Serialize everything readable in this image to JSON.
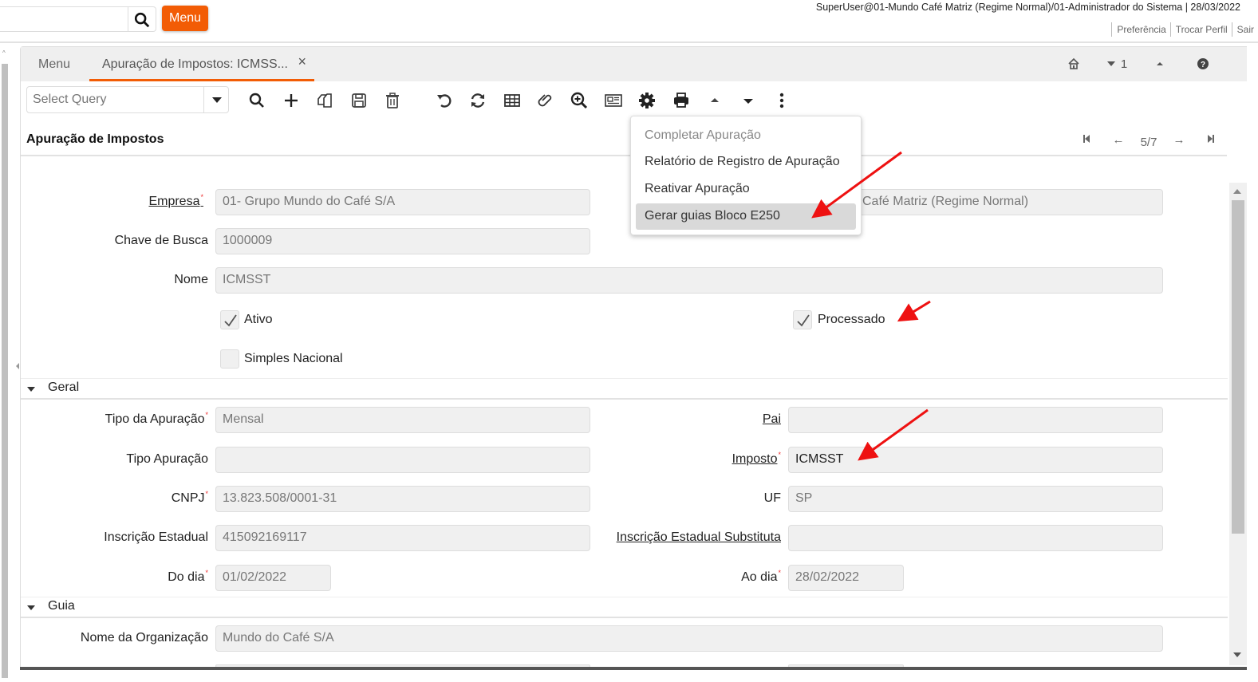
{
  "header": {
    "menu_button": "Menu",
    "user_info": "SuperUser@01-Mundo Café Matriz (Regime Normal)/01-Administrador do Sistema | 28/03/2022",
    "links": [
      "Preferência",
      "Trocar Perfil",
      "Sair"
    ]
  },
  "tabs": {
    "menu_tab": "Menu",
    "active_tab": "Apuração de Impostos: ICMSS...",
    "close_glyph": "×",
    "tools": {
      "home_icon": "home-icon",
      "recent_count": "1",
      "help_icon": "help-icon"
    }
  },
  "toolbar": {
    "query_placeholder": "Select Query",
    "icons": [
      "search-icon",
      "new-record-icon",
      "copy-icon",
      "save-icon",
      "delete-icon",
      "undo-icon",
      "refresh-icon",
      "grid-toggle-icon",
      "attachment-icon",
      "zoom-across-icon",
      "report-icon",
      "process-gear-icon",
      "print-icon",
      "previous-record-icon",
      "next-record-icon",
      "more-options-icon"
    ]
  },
  "record": {
    "title": "Apuração de Impostos",
    "position": "5/7"
  },
  "popup_menu": {
    "items": [
      {
        "label": "Completar Apuração",
        "state": "disabled"
      },
      {
        "label": "Relatório de Registro de Apuração",
        "state": "normal"
      },
      {
        "label": "Reativar Apuração",
        "state": "normal"
      },
      {
        "label": "Gerar guias Bloco E250",
        "state": "hover"
      }
    ]
  },
  "form": {
    "empresa": {
      "label": "Empresa",
      "value": "01- Grupo Mundo do Café S/A"
    },
    "organizacao": {
      "value": "Café Matriz (Regime Normal)"
    },
    "chave_busca": {
      "label": "Chave de Busca",
      "value": "1000009"
    },
    "nome": {
      "label": "Nome",
      "value": "ICMSST"
    },
    "ativo": {
      "label": "Ativo",
      "checked": true
    },
    "processado": {
      "label": "Processado",
      "checked": true
    },
    "simples_nacional": {
      "label": "Simples Nacional",
      "checked": false
    }
  },
  "sections": {
    "geral": {
      "name": "Geral",
      "tipo_da_apuracao": {
        "label": "Tipo da Apuração",
        "value": "Mensal"
      },
      "tipo_apuracao": {
        "label": "Tipo Apuração",
        "value": ""
      },
      "cnpj": {
        "label": "CNPJ",
        "value": "13.823.508/0001-31"
      },
      "inscricao_estadual": {
        "label": "Inscrição Estadual",
        "value": "415092169117"
      },
      "do_dia": {
        "label": "Do dia",
        "value": "01/02/2022"
      },
      "pai": {
        "label": "Pai",
        "value": ""
      },
      "imposto": {
        "label": "Imposto",
        "value": "ICMSST"
      },
      "uf": {
        "label": "UF",
        "value": "SP"
      },
      "ie_substituta": {
        "label": "Inscrição Estadual Substituta",
        "value": ""
      },
      "ao_dia": {
        "label": "Ao dia",
        "value": "28/02/2022"
      }
    },
    "guia": {
      "name": "Guia",
      "nome_organizacao": {
        "label": "Nome da Organização",
        "value": "Mundo do Café S/A"
      }
    }
  },
  "colors": {
    "accent": "#f25c05",
    "annotation_arrow": "#ee1111",
    "field_bg": "#f0f0f0"
  }
}
